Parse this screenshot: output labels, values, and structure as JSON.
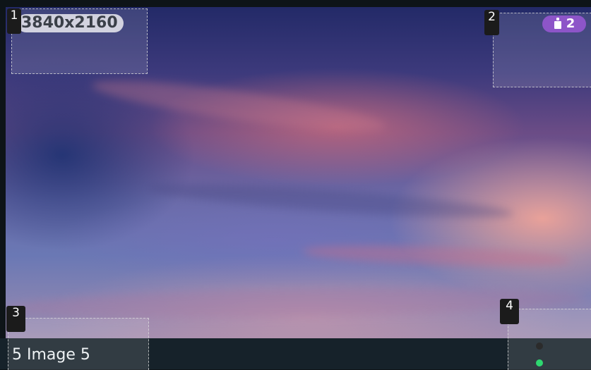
{
  "image": {
    "resolution": "3840x2160",
    "caption": "5 Image 5"
  },
  "badge": {
    "icon": "person-icon",
    "count": "2",
    "color": "#8d55c8"
  },
  "regions": [
    {
      "marker": "1"
    },
    {
      "marker": "2"
    },
    {
      "marker": "3"
    },
    {
      "marker": "4"
    }
  ],
  "indicators": [
    {
      "state": "inactive",
      "color": "#2b2b2b"
    },
    {
      "state": "active",
      "color": "#2ed870"
    }
  ]
}
